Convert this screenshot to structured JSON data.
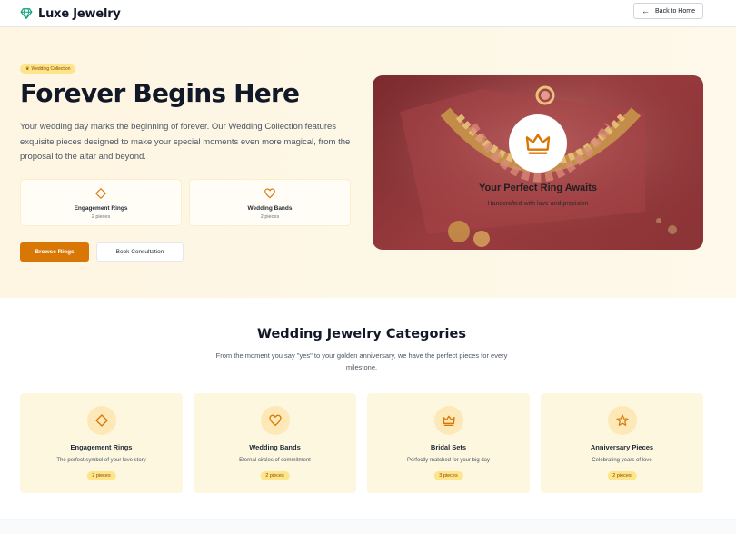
{
  "header": {
    "brand": "Luxe Jewelry",
    "back_label": "Back to Home"
  },
  "hero": {
    "badge": "Wedding Collection",
    "title": "Forever Begins Here",
    "description": "Your wedding day marks the beginning of forever. Our Wedding Collection features exquisite pieces designed to make your special moments even more magical, from the proposal to the altar and beyond.",
    "stats": [
      {
        "title": "Engagement Rings",
        "count": "2 pieces",
        "icon": "diamond-icon"
      },
      {
        "title": "Wedding Bands",
        "count": "2 pieces",
        "icon": "heart-icon"
      }
    ],
    "primary_button": "Browse Rings",
    "secondary_button": "Book Consultation",
    "image": {
      "title": "Your Perfect Ring Awaits",
      "subtitle": "Handcrafted with love and precision"
    }
  },
  "categories": {
    "title": "Wedding Jewelry Categories",
    "description": "From the moment you say \"yes\" to your golden anniversary, we have the perfect pieces for every milestone.",
    "items": [
      {
        "name": "Engagement Rings",
        "subtitle": "The perfect symbol of your love story",
        "count": "2 pieces",
        "icon": "diamond-icon"
      },
      {
        "name": "Wedding Bands",
        "subtitle": "Eternal circles of commitment",
        "count": "2 pieces",
        "icon": "heart-icon"
      },
      {
        "name": "Bridal Sets",
        "subtitle": "Perfectly matched for your big day",
        "count": "3 pieces",
        "icon": "crown-icon"
      },
      {
        "name": "Anniversary Pieces",
        "subtitle": "Celebrating years of love",
        "count": "2 pieces",
        "icon": "star-icon"
      }
    ]
  },
  "colors": {
    "accent": "#d97706",
    "brand_green": "#0f9d7a",
    "hero_bg": "#fef6e2",
    "badge_bg": "#fde68a",
    "image_bg": "#8b3336"
  }
}
